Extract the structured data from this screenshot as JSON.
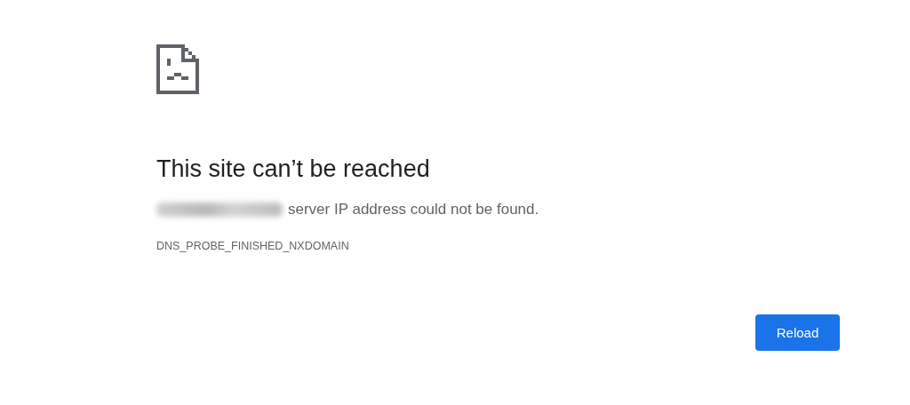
{
  "error_page": {
    "title": "This site can’t be reached",
    "message": "server IP address could not be found.",
    "error_code": "DNS_PROBE_FINISHED_NXDOMAIN",
    "buttons": [
      {
        "label": "Reload"
      }
    ]
  }
}
